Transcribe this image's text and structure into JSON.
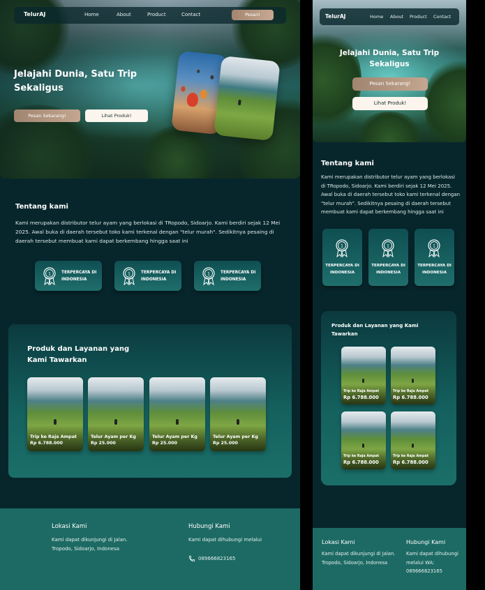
{
  "brand": "TelurAJ",
  "nav": {
    "links": [
      "Home",
      "About",
      "Product",
      "Contact"
    ],
    "cta": "Pesan!"
  },
  "hero": {
    "title": "Jelajahi Dunia, Satu Trip Sekaligus",
    "primary_button": "Pesan Sekarang!",
    "secondary_button": "Lihat Produk!"
  },
  "about": {
    "title": "Tentang kami",
    "text": "Kami merupakan distributor telur ayam yang berlokasi di TRopodo, Sidoarjo. Kami berdiri sejak 12 Mei 2025. Awal buka di daerah tersebut  toko kami terkenal dengan \"telur murah\". Sedikitnya pesaing di daerah tersebut membuat kami dapat berkembang hingga saat ini",
    "badges": [
      "TERPERCAYA DI INDONESIA",
      "TERPERCAYA DI INDONESIA",
      "TERPERCAYA DI INDONESIA"
    ]
  },
  "products": {
    "title": "Produk dan Layanan yang Kami Tawarkan",
    "desktop_items": [
      {
        "name": "Trip ke Raja Ampat",
        "price": "Rp 6.788.000"
      },
      {
        "name": "Telur Ayam per Kg",
        "price": "Rp 25.000"
      },
      {
        "name": "Telur Ayam per Kg",
        "price": "Rp 25.000"
      },
      {
        "name": "Telur Ayam per Kg",
        "price": "Rp 25.000"
      }
    ],
    "mobile_items": [
      {
        "name": "Trip ke Raja Ampat",
        "price": "Rp 6.788.000"
      },
      {
        "name": "Trip ke Raja Ampat",
        "price": "Rp 6.788.000"
      },
      {
        "name": "Trip ke Raja Ampat",
        "price": "Rp 6.788.000"
      },
      {
        "name": "Trip ke Raja Ampat",
        "price": "Rp 6.788.000"
      }
    ]
  },
  "footer": {
    "location_title": "Lokasi Kami",
    "location_text": "Kami dapat dikunjungi di Jalan. Tropodo, Sidoarjo, Indonesa",
    "contact_title": "Hubungi Kami",
    "contact_text": "Kami dapat dihubungi melalui",
    "phone": "089666823165",
    "mobile_contact_text": "Kami dapat dihubungi melalui WA: 089666823165"
  },
  "colors": {
    "page_bg": "#07262c",
    "accent_tan": "#b0937c",
    "footer_bg": "#1d6a64",
    "card_teal": "#14605e"
  },
  "icons": [
    "medal-icon",
    "phone-icon"
  ]
}
